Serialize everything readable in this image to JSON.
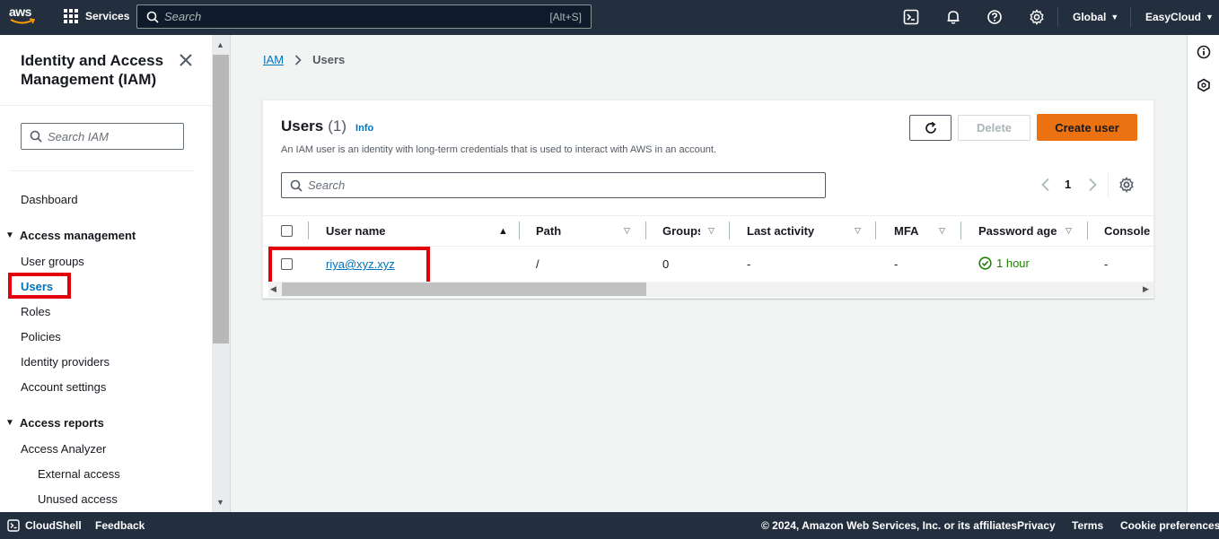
{
  "topnav": {
    "logo": "aws",
    "services_label": "Services",
    "search_placeholder": "Search",
    "search_shortcut": "[Alt+S]",
    "region": "Global",
    "account": "EasyCloud"
  },
  "sidebar": {
    "title": "Identity and Access Management (IAM)",
    "search_placeholder": "Search IAM",
    "dashboard": "Dashboard",
    "section_access_management": "Access management",
    "access_management_items": [
      "User groups",
      "Users",
      "Roles",
      "Policies",
      "Identity providers",
      "Account settings"
    ],
    "section_access_reports": "Access reports",
    "access_reports_items": [
      "Access Analyzer",
      "External access",
      "Unused access"
    ]
  },
  "breadcrumb": {
    "root": "IAM",
    "current": "Users"
  },
  "panel": {
    "title": "Users",
    "count": "(1)",
    "info": "Info",
    "description": "An IAM user is an identity with long-term credentials that is used to interact with AWS in an account.",
    "delete_label": "Delete",
    "create_label": "Create user",
    "search_placeholder": "Search",
    "page_number": "1"
  },
  "table": {
    "columns": [
      "User name",
      "Path",
      "Groups",
      "Last activity",
      "MFA",
      "Password age",
      "Console l"
    ],
    "rows": [
      {
        "user_name": "riya@xyz.xyz",
        "path": "/",
        "groups": "0",
        "last_activity": "-",
        "mfa": "-",
        "password_age": "1 hour",
        "console": "-"
      }
    ]
  },
  "footer": {
    "cloudshell": "CloudShell",
    "feedback": "Feedback",
    "copyright": "© 2024, Amazon Web Services, Inc. or its affiliates.",
    "privacy": "Privacy",
    "terms": "Terms",
    "cookies": "Cookie preferences"
  },
  "colors": {
    "nav_bg": "#232f3e",
    "accent_link": "#0073bb",
    "primary_button": "#ec7211",
    "highlight_box": "#e4000a",
    "success": "#1d8102"
  },
  "icons": [
    "grid-icon",
    "search-icon",
    "cloudshell-icon",
    "bell-icon",
    "help-icon",
    "settings-icon",
    "close-icon",
    "refresh-icon",
    "chevron-left-icon",
    "chevron-right-icon",
    "gear-icon",
    "info-icon",
    "hexagon-icon",
    "check-circle-icon"
  ]
}
